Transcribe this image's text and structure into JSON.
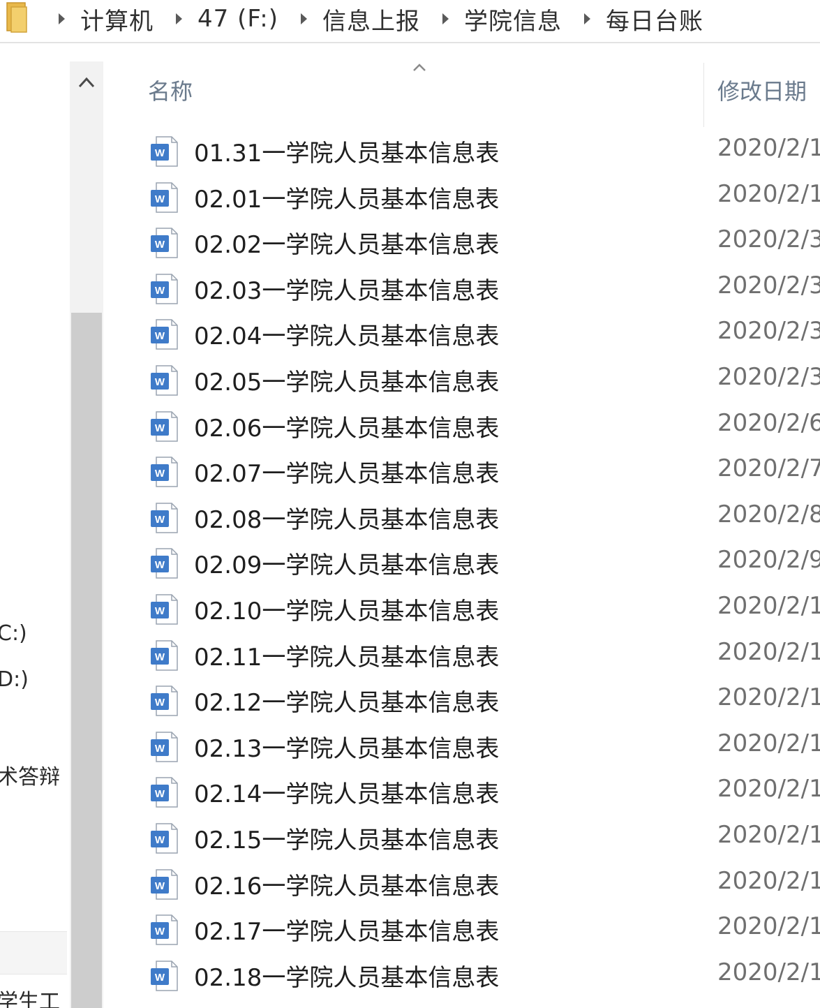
{
  "breadcrumb": {
    "items": [
      "计算机",
      "47 (F:)",
      "信息上报",
      "学院信息",
      "每日台账"
    ]
  },
  "nav": {
    "items": [
      "C:)",
      "D:)",
      "术答辩",
      "学生工"
    ]
  },
  "columns": {
    "name": "名称",
    "date": "修改日期"
  },
  "files": [
    {
      "name": "01.31一学院人员基本信息表",
      "date": "2020/2/1"
    },
    {
      "name": "02.01一学院人员基本信息表",
      "date": "2020/2/1"
    },
    {
      "name": "02.02一学院人员基本信息表",
      "date": "2020/2/3"
    },
    {
      "name": "02.03一学院人员基本信息表",
      "date": "2020/2/3"
    },
    {
      "name": "02.04一学院人员基本信息表",
      "date": "2020/2/3"
    },
    {
      "name": "02.05一学院人员基本信息表",
      "date": "2020/2/3"
    },
    {
      "name": "02.06一学院人员基本信息表",
      "date": "2020/2/6"
    },
    {
      "name": "02.07一学院人员基本信息表",
      "date": "2020/2/7"
    },
    {
      "name": "02.08一学院人员基本信息表",
      "date": "2020/2/8"
    },
    {
      "name": "02.09一学院人员基本信息表",
      "date": "2020/2/9"
    },
    {
      "name": "02.10一学院人员基本信息表",
      "date": "2020/2/1"
    },
    {
      "name": "02.11一学院人员基本信息表",
      "date": "2020/2/1"
    },
    {
      "name": "02.12一学院人员基本信息表",
      "date": "2020/2/1"
    },
    {
      "name": "02.13一学院人员基本信息表",
      "date": "2020/2/1"
    },
    {
      "name": "02.14一学院人员基本信息表",
      "date": "2020/2/1"
    },
    {
      "name": "02.15一学院人员基本信息表",
      "date": "2020/2/1"
    },
    {
      "name": "02.16一学院人员基本信息表",
      "date": "2020/2/1"
    },
    {
      "name": "02.17一学院人员基本信息表",
      "date": "2020/2/1"
    },
    {
      "name": "02.18一学院人员基本信息表",
      "date": "2020/2/1"
    }
  ],
  "icons": {
    "breadcrumb_folder": "folder-icon",
    "file": "word-document-icon",
    "scroll_up": "chevron-up-icon",
    "sort": "sort-ascending-icon"
  },
  "colors": {
    "word_icon_blue": "#3f7bc9",
    "header_text": "#6a7a8c",
    "scroll_thumb": "#cdcdcd"
  }
}
